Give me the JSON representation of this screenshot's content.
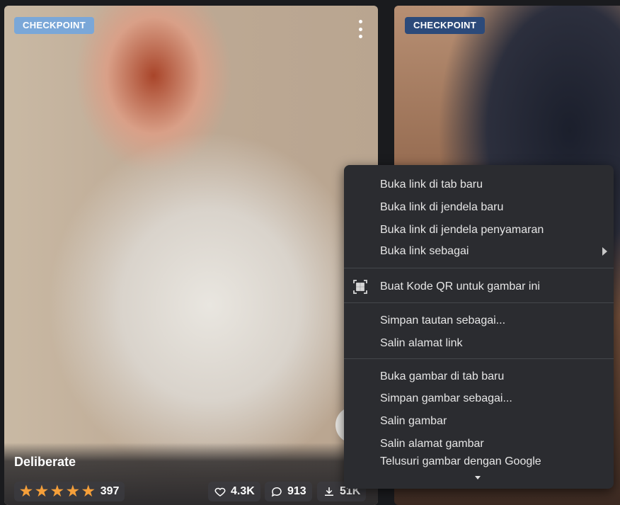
{
  "cards": [
    {
      "badge": "CHECKPOINT",
      "title": "Deliberate",
      "rating": {
        "stars": 5,
        "count": "397"
      },
      "likes": "4.3K",
      "comments": "913",
      "downloads": "51K"
    },
    {
      "badge": "CHECKPOINT"
    }
  ],
  "context_menu": {
    "groups": [
      {
        "items": [
          "Buka link di tab baru",
          "Buka link di jendela baru",
          "Buka link di jendela penyamaran",
          "Buka link sebagai"
        ]
      },
      {
        "items": [
          "Buat Kode QR untuk gambar ini"
        ]
      },
      {
        "items": [
          "Simpan tautan sebagai...",
          "Salin alamat link"
        ]
      },
      {
        "items": [
          "Buka gambar di tab baru",
          "Simpan gambar sebagai...",
          "Salin gambar",
          "Salin alamat gambar",
          "Telusuri gambar dengan Google"
        ]
      }
    ],
    "highlighted_item": "Salin alamat link"
  },
  "colors": {
    "accent_star": "#f59f3a",
    "underline": "#d8252e",
    "menu_bg": "#2b2c30"
  }
}
